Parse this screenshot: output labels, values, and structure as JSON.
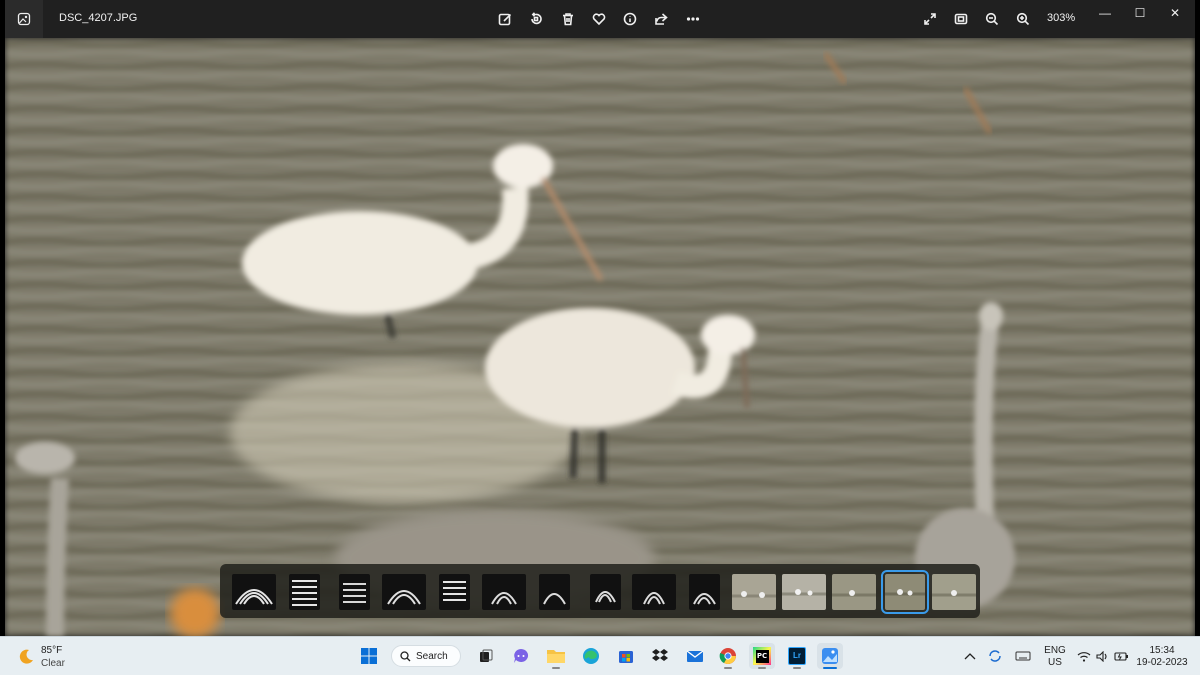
{
  "window": {
    "filename": "DSC_4207.JPG",
    "zoom": "303%"
  },
  "toolbar": {
    "icons": [
      "edit-image-icon",
      "rotate-icon",
      "delete-icon",
      "favorite-icon",
      "info-icon",
      "share-icon",
      "more-icon"
    ],
    "right_icons": [
      "full-screen-icon",
      "fit-to-window-icon",
      "zoom-out-icon",
      "zoom-in-icon"
    ]
  },
  "window_controls": {
    "minimize": "—",
    "maximize": "☐",
    "close": "✕"
  },
  "filmstrip": {
    "selected_index": 13,
    "count": 15
  },
  "taskbar": {
    "weather": {
      "temp": "85°F",
      "condition": "Clear"
    },
    "search_label": "Search",
    "apps": [
      "windows-start",
      "search",
      "task-view",
      "chat",
      "file-explorer",
      "edge",
      "microsoft-store",
      "dropbox",
      "mail",
      "chrome",
      "pycharm",
      "lightroom",
      "photos"
    ],
    "pycharm_label": "PC",
    "lightroom_label": "Lr",
    "language": {
      "line1": "ENG",
      "line2": "US"
    },
    "time": "15:34",
    "date": "19-02-2023"
  }
}
